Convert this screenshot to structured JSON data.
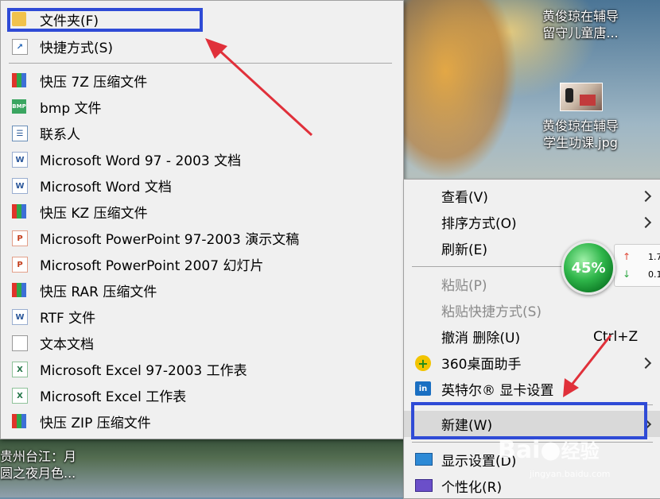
{
  "desktop": {
    "icon1_line1": "黄俊琼在辅导",
    "icon1_line2": "留守儿童唐...",
    "icon2_line1": "黄俊琼在辅导",
    "icon2_line2": "学生功课.jpg",
    "icon3_line1": "贵州台江：月",
    "icon3_line2": "圆之夜月色..."
  },
  "new_submenu": {
    "items": [
      {
        "label": "文件夹(F)",
        "icon": "folder-icon"
      },
      {
        "label": "快捷方式(S)",
        "icon": "shortcut-icon"
      },
      {
        "label": "快压 7Z 压缩文件",
        "icon": "kuaiya-archive-icon"
      },
      {
        "label": "bmp 文件",
        "icon": "bmp-file-icon"
      },
      {
        "label": "联系人",
        "icon": "contact-icon"
      },
      {
        "label": "Microsoft Word 97 - 2003 文档",
        "icon": "word-doc-icon"
      },
      {
        "label": "Microsoft Word 文档",
        "icon": "word-doc-icon"
      },
      {
        "label": "快压 KZ 压缩文件",
        "icon": "kuaiya-archive-icon"
      },
      {
        "label": "Microsoft PowerPoint 97-2003 演示文稿",
        "icon": "powerpoint-icon"
      },
      {
        "label": "Microsoft PowerPoint 2007 幻灯片",
        "icon": "powerpoint-icon"
      },
      {
        "label": "快压 RAR 压缩文件",
        "icon": "kuaiya-archive-icon"
      },
      {
        "label": "RTF 文件",
        "icon": "rtf-file-icon"
      },
      {
        "label": "文本文档",
        "icon": "text-file-icon"
      },
      {
        "label": "Microsoft Excel 97-2003 工作表",
        "icon": "excel-icon"
      },
      {
        "label": "Microsoft Excel 工作表",
        "icon": "excel-icon"
      },
      {
        "label": "快压 ZIP 压缩文件",
        "icon": "kuaiya-archive-icon"
      }
    ]
  },
  "context_menu": {
    "view": "查看(V)",
    "sort": "排序方式(O)",
    "refresh": "刷新(E)",
    "paste": "粘贴(P)",
    "paste_shortcut": "粘贴快捷方式(S)",
    "undo": "撤消 删除(U)",
    "undo_shortcut": "Ctrl+Z",
    "desktop360": "360桌面助手",
    "intel": "英特尔® 显卡设置",
    "new": "新建(W)",
    "display": "显示设置(D)",
    "personalize": "个性化(R)"
  },
  "widget": {
    "percent": "45%",
    "up_value": "1.7",
    "down_value": "0.1"
  },
  "watermark": {
    "brand": "Bai",
    "brand2": "经验",
    "url": "jingyan.baidu.com"
  },
  "colors": {
    "highlight_border": "#2f4bd6",
    "arrow": "#e0303a",
    "menu_bg": "#f0f0f0"
  }
}
